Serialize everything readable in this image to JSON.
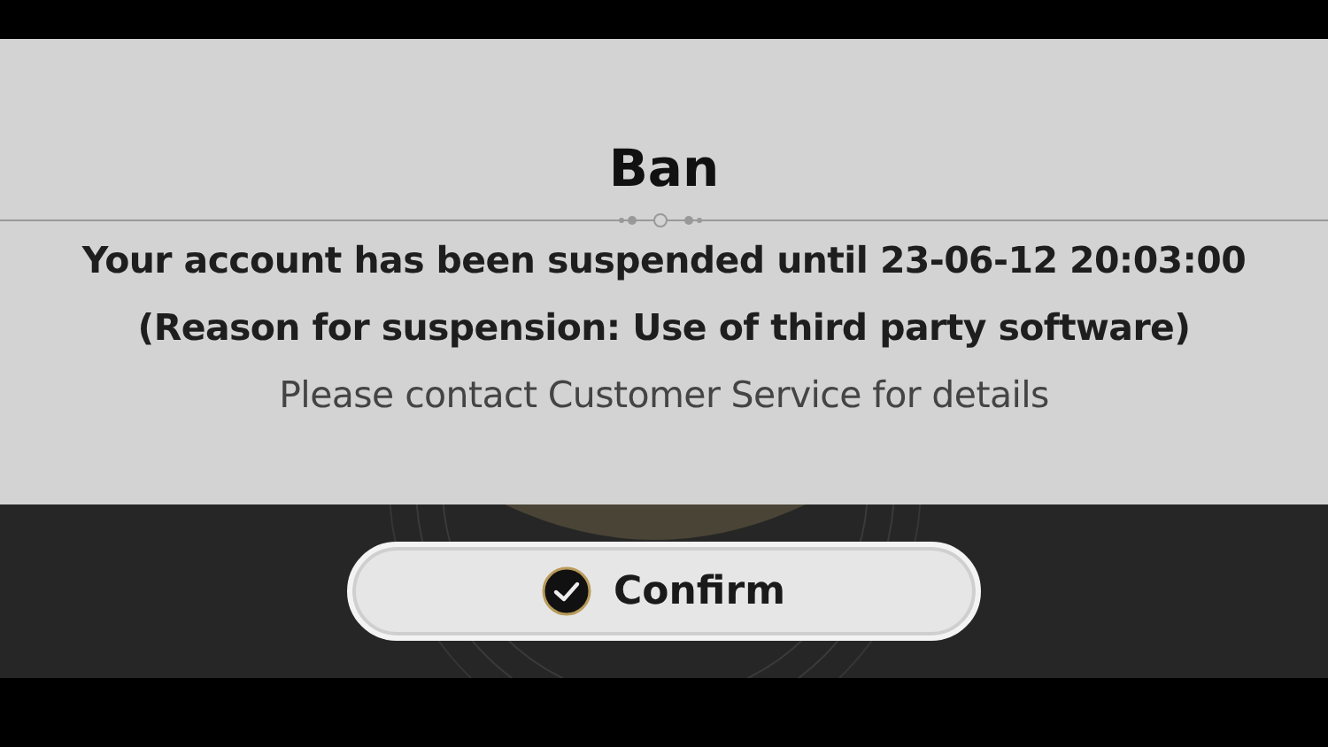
{
  "dialog": {
    "title": "Ban",
    "message": "Your account has been suspended until 23-06-12 20:03:00 (Reason for suspension: Use of third party software)",
    "note": "Please contact Customer Service for details"
  },
  "confirm_button": {
    "label": "Confirm"
  }
}
